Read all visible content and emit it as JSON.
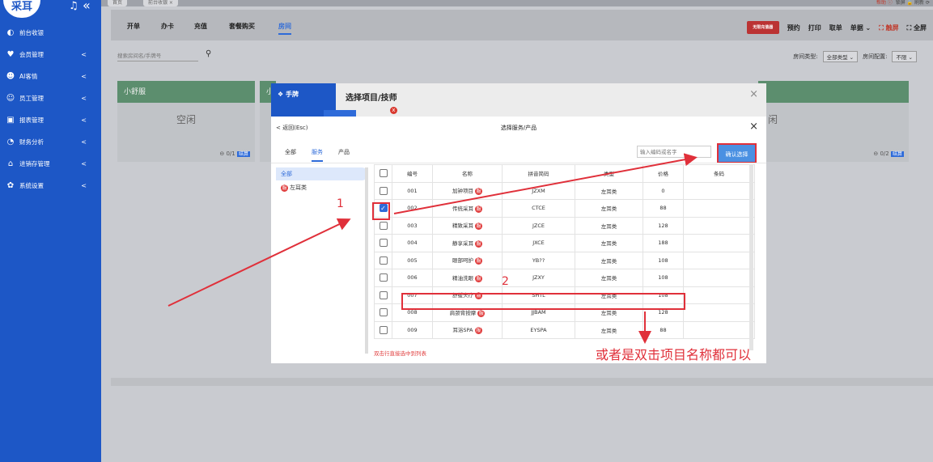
{
  "sidebar": {
    "logo": "采耳",
    "items": [
      {
        "icon": "◐",
        "label": "前台收银",
        "arrow": ""
      },
      {
        "icon": "♥",
        "label": "会员管理",
        "arrow": "<"
      },
      {
        "icon": "☻",
        "label": "AI客情",
        "arrow": "<"
      },
      {
        "icon": "☺",
        "label": "员工管理",
        "arrow": "<"
      },
      {
        "icon": "▣",
        "label": "报表管理",
        "arrow": "<"
      },
      {
        "icon": "◔",
        "label": "财务分析",
        "arrow": "<"
      },
      {
        "icon": "⌂",
        "label": "进销存管理",
        "arrow": "<"
      },
      {
        "icon": "✿",
        "label": "系统设置",
        "arrow": "<"
      }
    ]
  },
  "top": {
    "tabs": [
      "首页",
      "前台收银 ×"
    ],
    "links_prefix": "帮助 ⓘ",
    "links_rest": "锁屏 🔒  刷新 ⟳"
  },
  "toolbar": {
    "items": [
      "开单",
      "办卡",
      "充值",
      "套餐购买",
      "房间"
    ],
    "right_banner": "无限充值器",
    "right": [
      "预约",
      "打印",
      "取单",
      "单据 ⌄"
    ],
    "touch": "⛶ 触屏",
    "fullscreen": "⛶ 全屏"
  },
  "search": {
    "placeholder": "搜索房间名/手牌号",
    "room_type_label": "房间类型:",
    "room_type_value": "全部类型 ⌄",
    "room_config_label": "房间配置:",
    "room_config_value": "不限 ⌄"
  },
  "rooms": [
    {
      "name": "小舒服",
      "status": "空闲",
      "count": "⊖ 0/1",
      "settle": "结算"
    },
    {
      "name": "小",
      "status": "",
      "count": "",
      "settle": ""
    },
    {
      "name": "",
      "status": "闲",
      "count": "⊖ 0/2",
      "settle": "结算"
    }
  ],
  "outer_modal": {
    "badge": "❖ 手牌",
    "title": "选择项目/技师",
    "close": "×",
    "dot": "x"
  },
  "modal": {
    "back": "< 返回(Esc)",
    "title": "选择服务/产品",
    "close": "×",
    "tabs": [
      "全部",
      "服务",
      "产品"
    ],
    "code_placeholder": "输入编码或名字",
    "confirm": "确认选择",
    "categories": [
      "全部",
      "左耳类"
    ],
    "columns": [
      "编号",
      "名称",
      "拼音简码",
      "类型",
      "价格",
      "条码"
    ],
    "rows": [
      {
        "checked": false,
        "code": "001",
        "name": "加钟项目",
        "py": "JZXM",
        "type": "左耳类",
        "price": "0",
        "barcode": ""
      },
      {
        "checked": true,
        "code": "002",
        "name": "传统采耳",
        "py": "CTCE",
        "type": "左耳类",
        "price": "88",
        "barcode": ""
      },
      {
        "checked": false,
        "code": "003",
        "name": "精致采耳",
        "py": "JZCE",
        "type": "左耳类",
        "price": "128",
        "barcode": ""
      },
      {
        "checked": false,
        "code": "004",
        "name": "静享采耳",
        "py": "JXCE",
        "type": "左耳类",
        "price": "188",
        "barcode": ""
      },
      {
        "checked": false,
        "code": "005",
        "name": "眼部呵护",
        "py": "YB??",
        "type": "左耳类",
        "price": "108",
        "barcode": ""
      },
      {
        "checked": false,
        "code": "006",
        "name": "精油洗眼",
        "py": "JZXY",
        "type": "左耳类",
        "price": "108",
        "barcode": ""
      },
      {
        "checked": false,
        "code": "007",
        "name": "舒缓头疗",
        "py": "SHTL",
        "type": "左耳类",
        "price": "108",
        "barcode": ""
      },
      {
        "checked": false,
        "code": "008",
        "name": "肩颈背按摩",
        "py": "JJBAM",
        "type": "左耳类",
        "price": "128",
        "barcode": ""
      },
      {
        "checked": false,
        "code": "009",
        "name": "耳浴SPA",
        "py": "EYSPA",
        "type": "左耳类",
        "price": "88",
        "barcode": ""
      }
    ],
    "hint": "双击行直接选中到列表",
    "service_badge": "服"
  },
  "annotations": {
    "one": "1",
    "two": "2",
    "note": "或者是双击项目名称都可以",
    "color": "#e0303a"
  }
}
